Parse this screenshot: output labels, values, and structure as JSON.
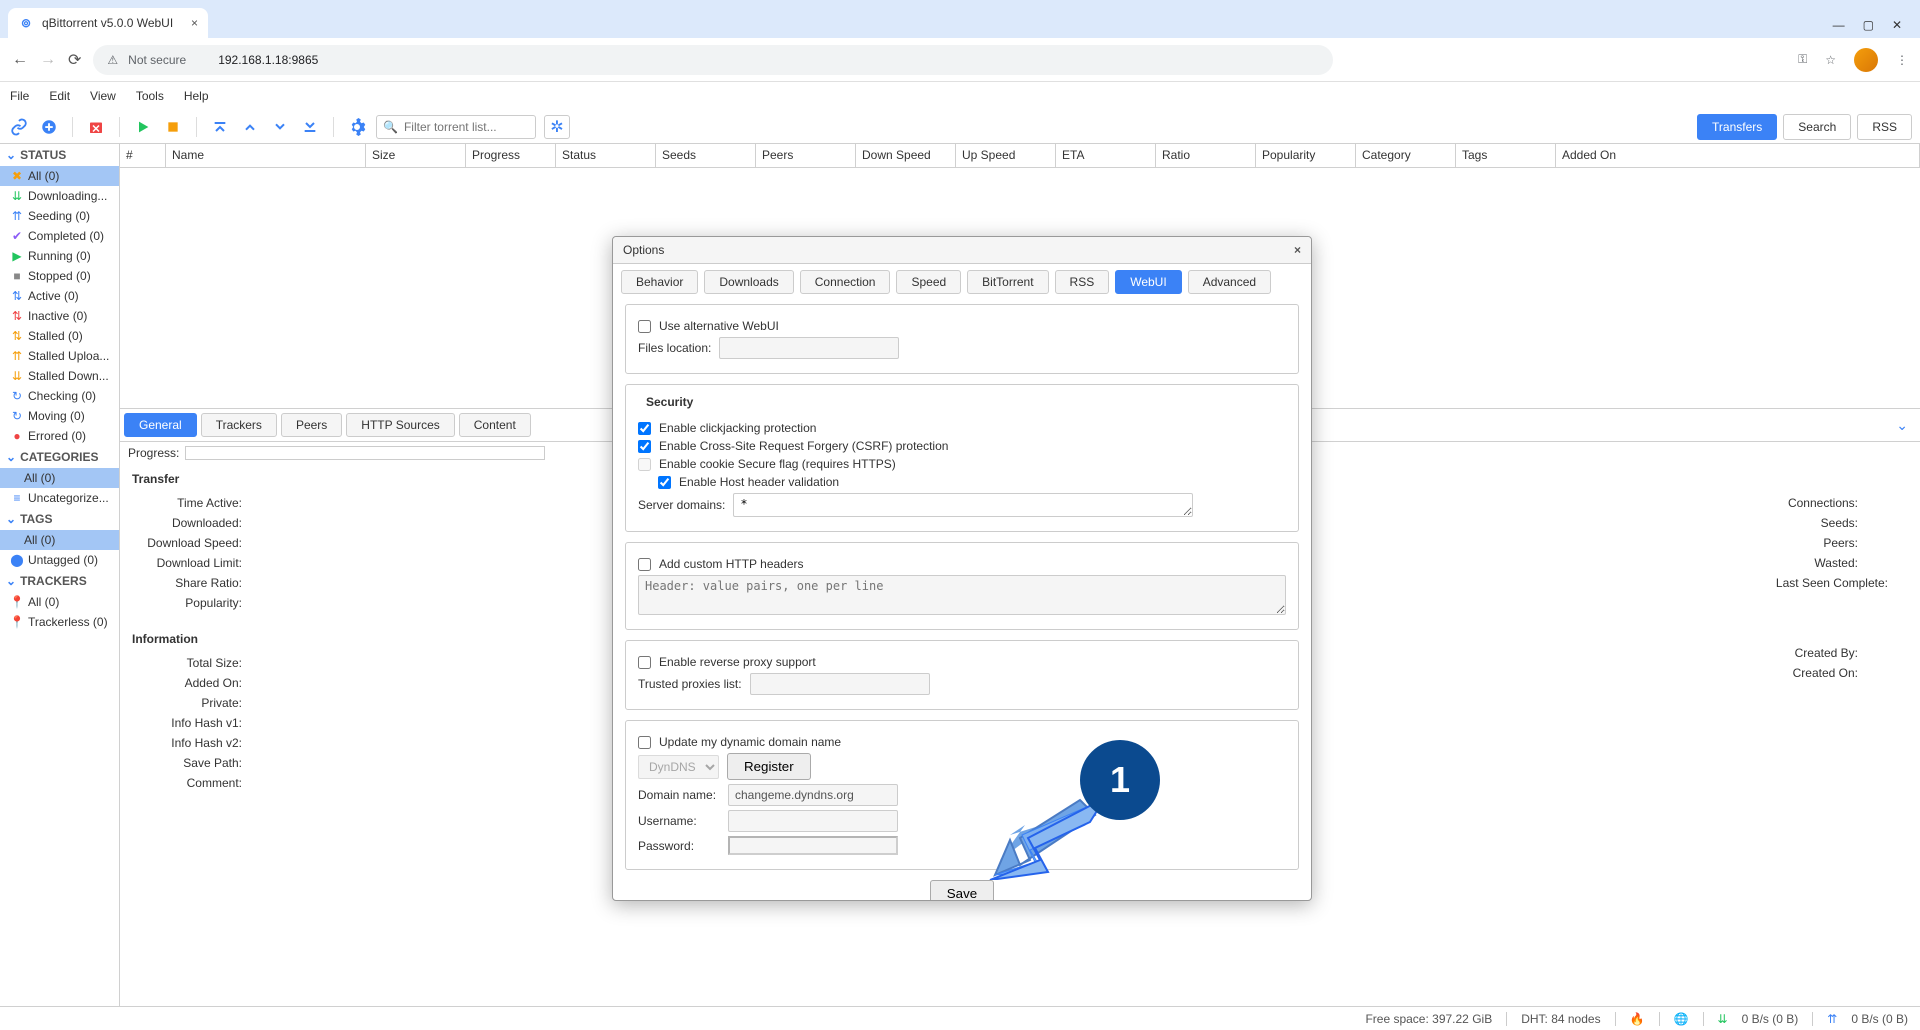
{
  "browser": {
    "tab_title": "qBittorrent v5.0.0 WebUI",
    "security_label": "Not secure",
    "url": "192.168.1.18:9865"
  },
  "menu": {
    "file": "File",
    "edit": "Edit",
    "view": "View",
    "tools": "Tools",
    "help": "Help"
  },
  "filter_placeholder": "Filter torrent list...",
  "top_tabs": {
    "transfers": "Transfers",
    "search": "Search",
    "rss": "RSS"
  },
  "sidebar": {
    "status": "STATUS",
    "items": [
      {
        "label": "All (0)"
      },
      {
        "label": "Downloading..."
      },
      {
        "label": "Seeding (0)"
      },
      {
        "label": "Completed (0)"
      },
      {
        "label": "Running (0)"
      },
      {
        "label": "Stopped (0)"
      },
      {
        "label": "Active (0)"
      },
      {
        "label": "Inactive (0)"
      },
      {
        "label": "Stalled (0)"
      },
      {
        "label": "Stalled Uploa..."
      },
      {
        "label": "Stalled Down..."
      },
      {
        "label": "Checking (0)"
      },
      {
        "label": "Moving (0)"
      },
      {
        "label": "Errored (0)"
      }
    ],
    "categories": "CATEGORIES",
    "cat_all": "All (0)",
    "cat_uncat": "Uncategorize...",
    "tags": "TAGS",
    "tags_all": "All (0)",
    "tags_untagged": "Untagged (0)",
    "trackers": "TRACKERS",
    "trk_all": "All (0)",
    "trk_trackerless": "Trackerless (0)"
  },
  "columns": [
    "#",
    "Name",
    "Size",
    "Progress",
    "Status",
    "Seeds",
    "Peers",
    "Down Speed",
    "Up Speed",
    "ETA",
    "Ratio",
    "Popularity",
    "Category",
    "Tags",
    "Added On"
  ],
  "detail_tabs": {
    "general": "General",
    "trackers": "Trackers",
    "peers": "Peers",
    "http": "HTTP Sources",
    "content": "Content"
  },
  "progress_label": "Progress:",
  "transfer": {
    "title": "Transfer",
    "rows": [
      "Time Active:",
      "Downloaded:",
      "Download Speed:",
      "Download Limit:",
      "Share Ratio:",
      "Popularity:"
    ]
  },
  "transfer_right": {
    "rows": [
      "Connections:",
      "Seeds:",
      "Peers:",
      "Wasted:",
      "Last Seen Complete:"
    ]
  },
  "info": {
    "title": "Information",
    "rows": [
      "Total Size:",
      "Added On:",
      "Private:",
      "Info Hash v1:",
      "Info Hash v2:",
      "Save Path:",
      "Comment:"
    ]
  },
  "info_right": {
    "rows": [
      "Created By:",
      "Created On:"
    ]
  },
  "modal": {
    "title": "Options",
    "tabs": {
      "behavior": "Behavior",
      "downloads": "Downloads",
      "connection": "Connection",
      "speed": "Speed",
      "bittorrent": "BitTorrent",
      "rss": "RSS",
      "webui": "WebUI",
      "advanced": "Advanced"
    },
    "alt_webui": "Use alternative WebUI",
    "files_location": "Files location:",
    "security": "Security",
    "clickjack": "Enable clickjacking protection",
    "csrf": "Enable Cross-Site Request Forgery (CSRF) protection",
    "cookie": "Enable cookie Secure flag (requires HTTPS)",
    "host_header": "Enable Host header validation",
    "server_domains": "Server domains:",
    "server_domains_val": "*",
    "custom_headers": "Add custom HTTP headers",
    "headers_placeholder": "Header: value pairs, one per line",
    "reverse_proxy": "Enable reverse proxy support",
    "trusted_proxies": "Trusted proxies list:",
    "dyndns": "Update my dynamic domain name",
    "dyndns_provider": "DynDNS",
    "register": "Register",
    "domain_name": "Domain name:",
    "domain_val": "changeme.dyndns.org",
    "username": "Username:",
    "password": "Password:",
    "save": "Save"
  },
  "callout": "1",
  "status_bar": {
    "free_space": "Free space: 397.22 GiB",
    "dht": "DHT: 84 nodes",
    "down": "0 B/s (0 B)",
    "up": "0 B/s (0 B)"
  }
}
